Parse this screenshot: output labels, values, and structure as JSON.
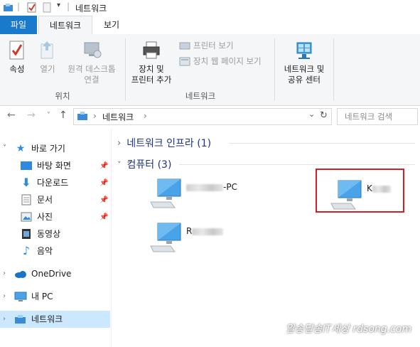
{
  "window": {
    "title": "네트워크"
  },
  "ribbon": {
    "tabs": {
      "file": "파일",
      "network": "네트워크",
      "view": "보기"
    },
    "buttons": {
      "properties": "속성",
      "open": "열기",
      "remote_desktop": [
        "원격 데스크톱",
        "연결"
      ],
      "devices_printers": [
        "장치 및",
        "프린터 추가"
      ],
      "view_printers": "프린터 보기",
      "view_device_webpage": "장치 웹 페이지 보기",
      "network_sharing": [
        "네트워크 및",
        "공유 센터"
      ]
    },
    "groups": {
      "location": "위치",
      "network": "네트워크"
    }
  },
  "address": {
    "path": "네트워크",
    "search_placeholder": "네트워크 검색"
  },
  "nav": {
    "quick_access": "바로 가기",
    "items": [
      "바탕 화면",
      "다운로드",
      "문서",
      "사진",
      "동영상",
      "음악"
    ],
    "onedrive": "OneDrive",
    "this_pc": "내 PC",
    "network": "네트워크"
  },
  "content": {
    "sections": [
      {
        "label": "네트워크 인프라 (1)",
        "collapsed": true
      },
      {
        "label": "컴퓨터 (3)",
        "collapsed": false
      }
    ],
    "computers": [
      {
        "visible_name": "-PC"
      },
      {
        "visible_name": "K"
      },
      {
        "visible_name": "R"
      }
    ]
  },
  "watermark": "알송달송IT세상 rdsong.com",
  "colors": {
    "file_tab": "#1979ca",
    "highlight": "#d11f26",
    "selection": "#cce8ff",
    "section_text": "#1e3287"
  }
}
